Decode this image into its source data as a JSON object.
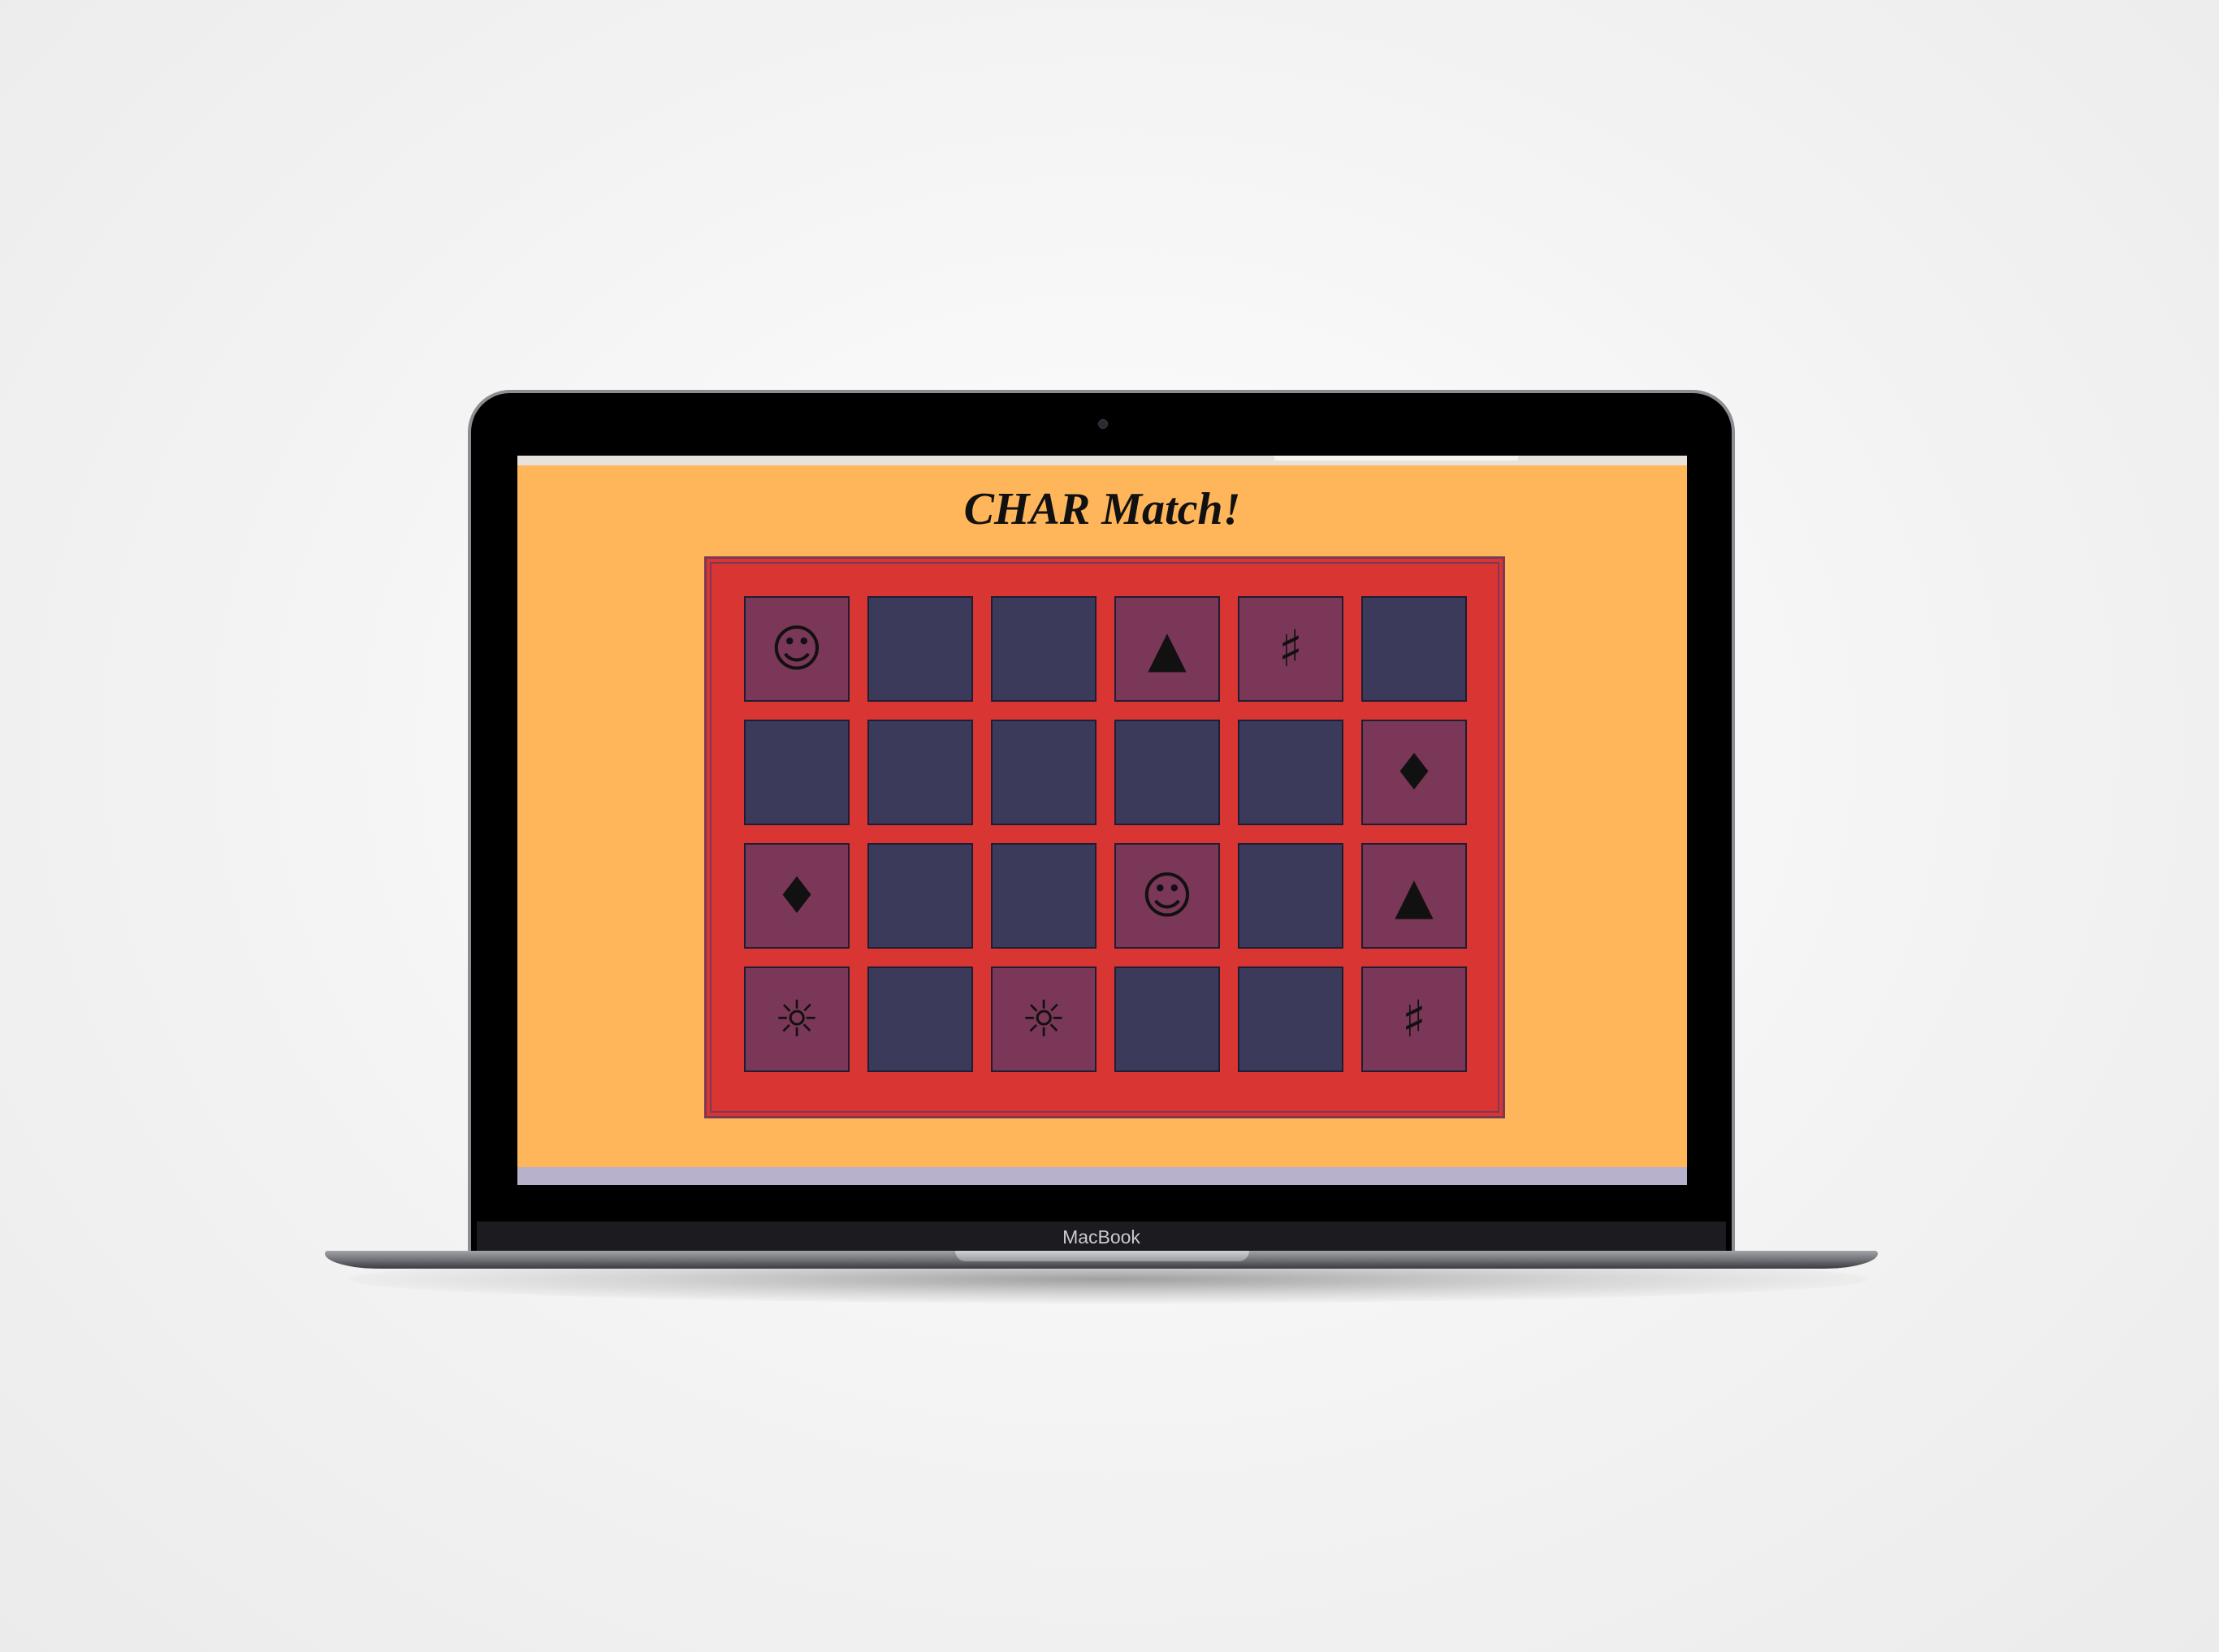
{
  "device": {
    "brand_label": "MacBook"
  },
  "game": {
    "title": "CHAR Match!",
    "colors": {
      "page_background": "#ffb55a",
      "board_background": "#d93533",
      "card_face_down": "#3b3a5b",
      "card_face_up": "#7b3757"
    },
    "cards": [
      {
        "face_up": true,
        "symbol": "☺",
        "icon": "smiley-icon"
      },
      {
        "face_up": false,
        "symbol": ""
      },
      {
        "face_up": false,
        "symbol": ""
      },
      {
        "face_up": true,
        "symbol": "▲",
        "icon": "triangle-icon"
      },
      {
        "face_up": true,
        "symbol": "♯",
        "icon": "sharp-icon"
      },
      {
        "face_up": false,
        "symbol": ""
      },
      {
        "face_up": false,
        "symbol": ""
      },
      {
        "face_up": false,
        "symbol": ""
      },
      {
        "face_up": false,
        "symbol": ""
      },
      {
        "face_up": false,
        "symbol": ""
      },
      {
        "face_up": false,
        "symbol": ""
      },
      {
        "face_up": true,
        "symbol": "♦",
        "icon": "diamond-icon"
      },
      {
        "face_up": true,
        "symbol": "♦",
        "icon": "diamond-icon"
      },
      {
        "face_up": false,
        "symbol": ""
      },
      {
        "face_up": false,
        "symbol": ""
      },
      {
        "face_up": true,
        "symbol": "☺",
        "icon": "smiley-icon"
      },
      {
        "face_up": false,
        "symbol": ""
      },
      {
        "face_up": true,
        "symbol": "▲",
        "icon": "triangle-icon"
      },
      {
        "face_up": true,
        "symbol": "☼",
        "icon": "sun-icon"
      },
      {
        "face_up": false,
        "symbol": ""
      },
      {
        "face_up": true,
        "symbol": "☼",
        "icon": "sun-icon"
      },
      {
        "face_up": false,
        "symbol": ""
      },
      {
        "face_up": false,
        "symbol": ""
      },
      {
        "face_up": true,
        "symbol": "♯",
        "icon": "sharp-icon"
      }
    ]
  }
}
